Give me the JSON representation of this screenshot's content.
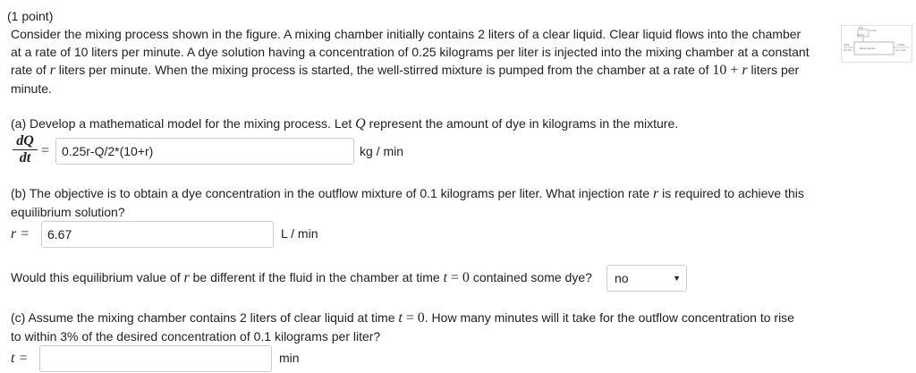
{
  "header": {
    "points": "(1 point)"
  },
  "intro": {
    "line1": "Consider the mixing process shown in the figure. A mixing chamber initially contains 2 liters of a clear liquid. Clear liquid flows into the chamber",
    "line2": "at a rate of 10 liters per minute. A dye solution having a concentration of 0.25 kilograms per liter is injected into the mixing chamber at a constant",
    "line3a": "rate of",
    "line3b": "liters per minute. When the mixing process is started, the well-stirred mixture is pumped from the chamber at a rate of",
    "line3c": "liters per",
    "line4": "minute."
  },
  "part_a": {
    "prompt": "(a) Develop a mathematical model for the mixing process. Let",
    "prompt_tail": "represent the amount of dye in kilograms in the mixture.",
    "answer": "0.25r-Q/2*(10+r)",
    "unit": "kg / min"
  },
  "part_b": {
    "prompt1": "(b) The objective is to obtain a dye concentration in the outflow mixture of 0.1 kilograms per liter. What injection rate",
    "prompt1_tail": "is required to achieve this",
    "prompt2": "equilibrium solution?",
    "answer": "6.67",
    "unit": "L / min",
    "question": "Would this equilibrium value of",
    "question_mid": "be different if the fluid in the chamber at time",
    "question_tail": "contained some dye?",
    "select_value": "no"
  },
  "part_c": {
    "prompt1": "(c) Assume the mixing chamber contains 2 liters of clear liquid at time",
    "prompt1_tail": ". How many minutes will it take for the outflow concentration to rise",
    "prompt2": "to within 3% of the desired concentration of 0.1 kilograms per liter?",
    "answer": "",
    "unit": "min"
  },
  "math": {
    "r": "r",
    "Q": "Q",
    "t": "t",
    "ten_plus_r": "10 + r",
    "t_eq_0": "= 0",
    "dQ": "dQ",
    "dt": "dt",
    "eq": "=",
    "r_eq": "r =",
    "t_eq": "t ="
  },
  "figure": {
    "label_dye": "Dye",
    "label_solution": "solution",
    "label_rate": "r L/min",
    "label_inflow": "Inflow",
    "label_inflow_rate": "10 L/min",
    "label_chamber": "Mixing chamber",
    "label_outflow": "Outflow",
    "label_outflow_rate": "10+r L/min"
  }
}
